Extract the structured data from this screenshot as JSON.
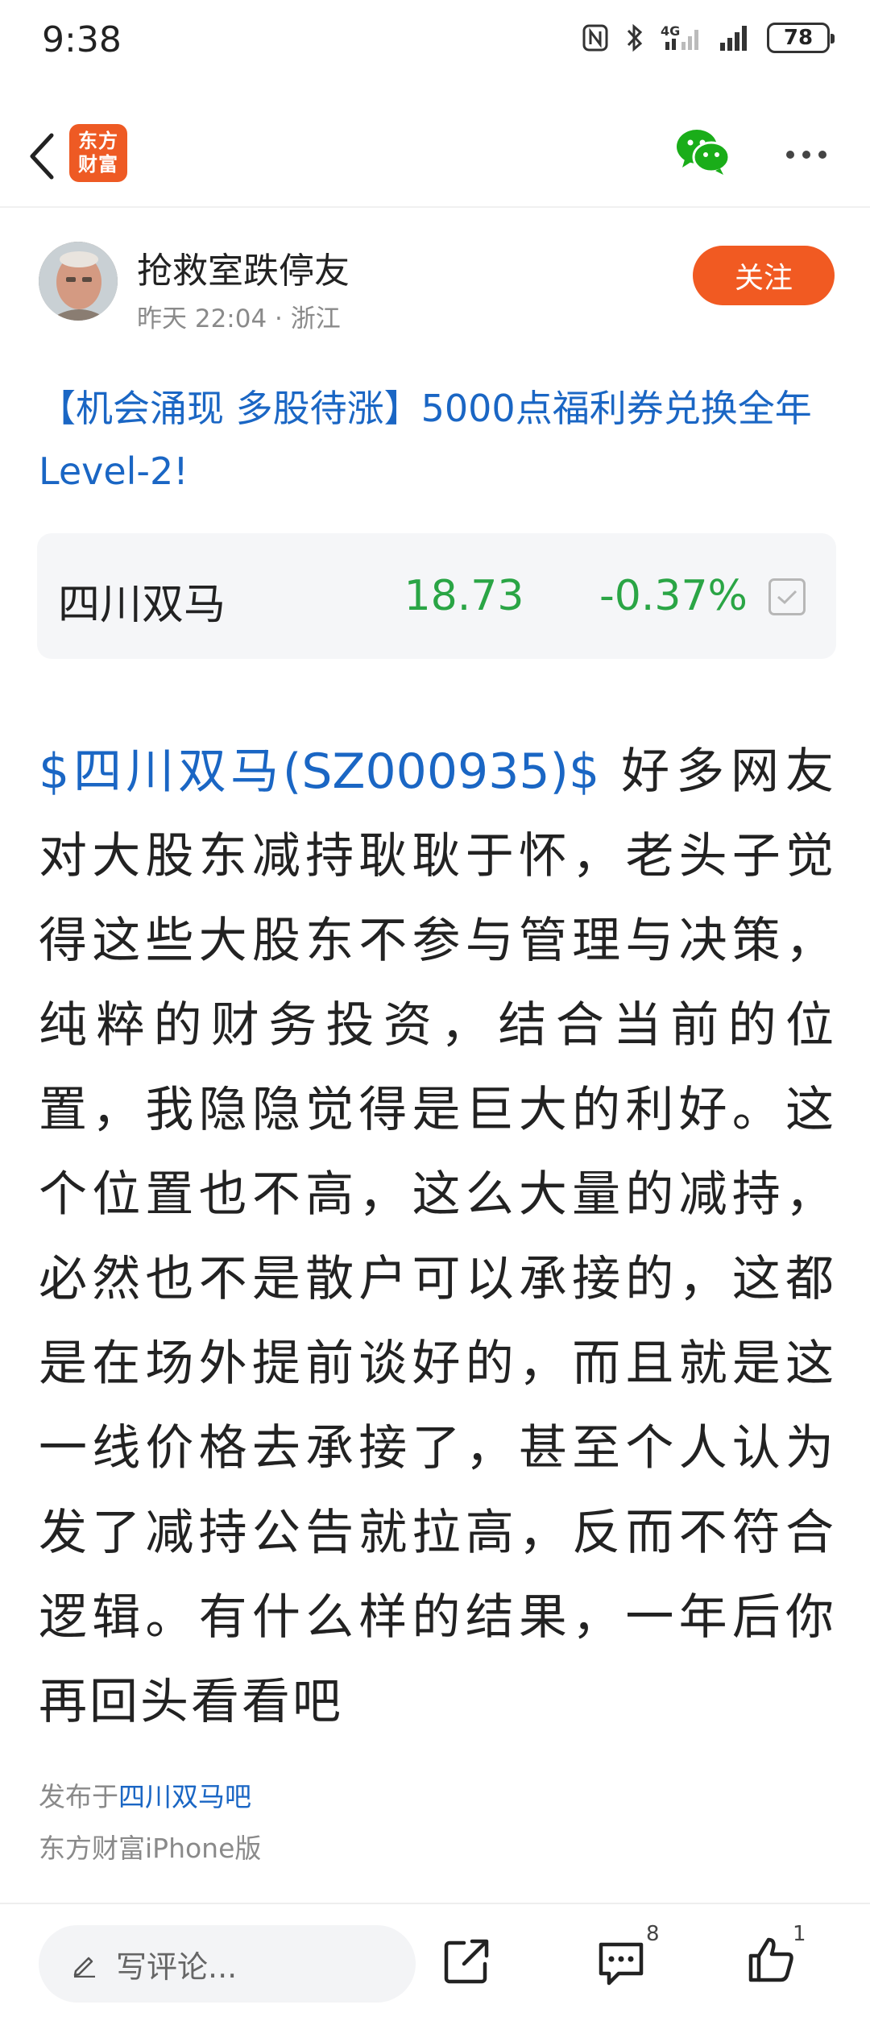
{
  "status_bar": {
    "time": "9:38",
    "network": "4G",
    "battery": "78",
    "icons": [
      "nfc-icon",
      "bluetooth-icon",
      "signal-4g-icon",
      "signal-icon",
      "battery-icon"
    ]
  },
  "nav": {
    "logo_line1": "东方",
    "logo_line2": "财富",
    "icons": [
      "back-icon",
      "wechat-icon",
      "more-icon"
    ],
    "logo_color": "#ee5a24",
    "wechat_color": "#1aad19"
  },
  "author": {
    "name": "抢救室跌停友",
    "meta": "昨天 22:04 · 浙江",
    "follow_label": "关注",
    "follow_color": "#f15a22"
  },
  "promo": {
    "title": "【机会涌现 多股待涨】5000点福利券兑换全年Level-2!",
    "color": "#1a66c4"
  },
  "stock": {
    "name": "四川双马",
    "price": "18.73",
    "change": "-0.37%",
    "down_color": "#2aa545"
  },
  "post": {
    "stock_tag": "$四川双马(SZ000935)$",
    "text": " 好多网友对大股东减持耿耿于怀，老头子觉得这些大股东不参与管理与决策，纯粹的财务投资，结合当前的位置，我隐隐觉得是巨大的利好。这个位置也不高，这么大量的减持，必然也不是散户可以承接的，这都是在场外提前谈好的，而且就是这一线价格去承接了，甚至个人认为发了减持公告就拉高，反而不符合逻辑。有什么样的结果，一年后你再回头看看吧"
  },
  "footer": {
    "published_prefix": "发布于",
    "published_link": "四川双马吧",
    "client": "东方财富iPhone版"
  },
  "bottom_bar": {
    "comment_placeholder": "写评论...",
    "comment_count": "8",
    "like_count": "1",
    "icons": [
      "pencil-icon",
      "share-icon",
      "comment-icon",
      "like-icon"
    ]
  }
}
